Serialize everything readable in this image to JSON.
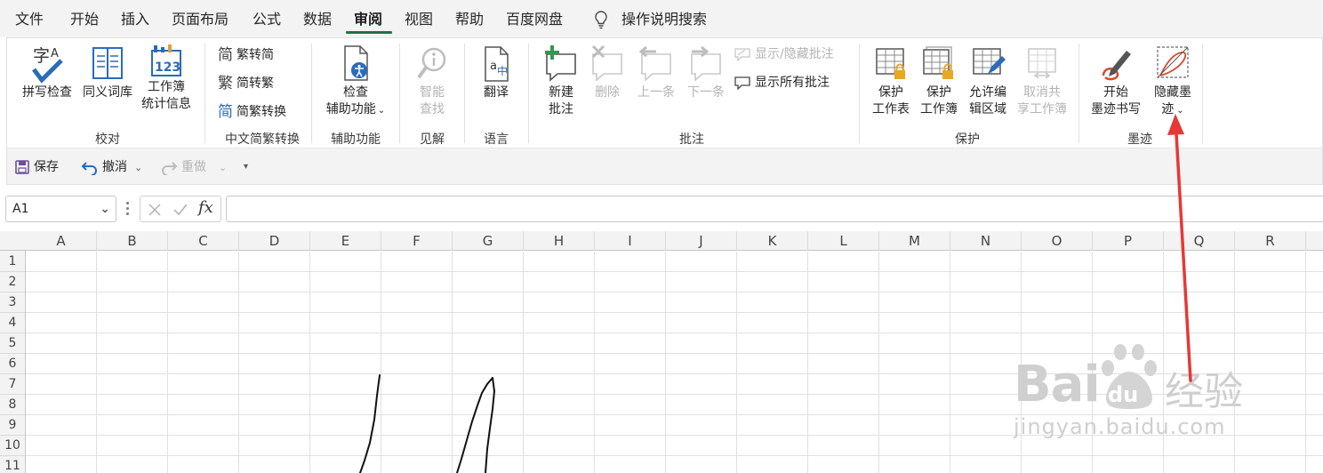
{
  "menu": {
    "tabs": [
      {
        "label": "文件"
      },
      {
        "label": "开始"
      },
      {
        "label": "插入"
      },
      {
        "label": "页面布局"
      },
      {
        "label": "公式"
      },
      {
        "label": "数据"
      },
      {
        "label": "审阅",
        "active": true
      },
      {
        "label": "视图"
      },
      {
        "label": "帮助"
      },
      {
        "label": "百度网盘"
      }
    ],
    "search_label": "操作说明搜索"
  },
  "ribbon": {
    "proofing": {
      "group_label": "校对",
      "spelling": "拼写检查",
      "thesaurus": "同义词库",
      "stats_line1": "工作簿",
      "stats_line2": "统计信息"
    },
    "chinese": {
      "group_label": "中文简繁转换",
      "to_simplified": "繁转简",
      "to_traditional": "简转繁",
      "convert": "简繁转换",
      "glyph_jian": "简",
      "glyph_fan": "繁"
    },
    "accessibility": {
      "group_label": "辅助功能",
      "check_line1": "检查",
      "check_line2": "辅助功能"
    },
    "insights": {
      "group_label": "见解",
      "smart_line1": "智能",
      "smart_line2": "查找"
    },
    "language": {
      "group_label": "语言",
      "translate": "翻译"
    },
    "comments": {
      "group_label": "批注",
      "new_line1": "新建",
      "new_line2": "批注",
      "delete": "删除",
      "previous": "上一条",
      "next": "下一条",
      "show_hide": "显示/隐藏批注",
      "show_all": "显示所有批注"
    },
    "protect": {
      "group_label": "保护",
      "sheet_line1": "保护",
      "sheet_line2": "工作表",
      "book_line1": "保护",
      "book_line2": "工作簿",
      "ranges_line1": "允许编",
      "ranges_line2": "辑区域",
      "unshare_line1": "取消共",
      "unshare_line2": "享工作簿"
    },
    "ink": {
      "group_label": "墨迹",
      "start_line1": "开始",
      "start_line2": "墨迹书写",
      "hide_line1": "隐藏墨",
      "hide_line2": "迹"
    }
  },
  "qat": {
    "save": "保存",
    "undo": "撤消",
    "redo": "重做"
  },
  "formula_bar": {
    "name_box": "A1",
    "fx": "fx"
  },
  "grid": {
    "columns": [
      "A",
      "B",
      "C",
      "D",
      "E",
      "F",
      "G",
      "H",
      "I",
      "J",
      "K",
      "L",
      "M",
      "N",
      "O",
      "P",
      "Q",
      "R"
    ],
    "rows": [
      "1",
      "2",
      "3",
      "4",
      "5",
      "6",
      "7",
      "8",
      "9",
      "10",
      "11"
    ]
  },
  "watermark": {
    "brand_latin": "Bai",
    "brand_du": "du",
    "brand_cn": "经验",
    "url": "jingyan.baidu.com"
  },
  "colors": {
    "accent_green": "#217346",
    "arrow_red": "#e53935"
  }
}
